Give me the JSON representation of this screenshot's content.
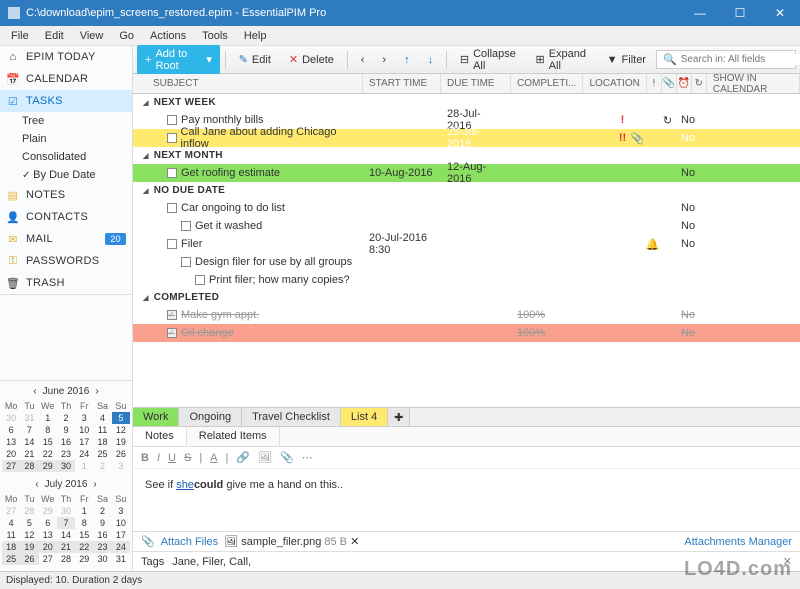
{
  "window": {
    "title": "C:\\download\\epim_screens_restored.epim - EssentialPIM Pro"
  },
  "menu": [
    "File",
    "Edit",
    "View",
    "Go",
    "Actions",
    "Tools",
    "Help"
  ],
  "sidebar": {
    "items": [
      {
        "label": "EPIM TODAY",
        "icon": "home"
      },
      {
        "label": "CALENDAR",
        "icon": "calendar"
      },
      {
        "label": "TASKS",
        "icon": "tasks",
        "active": true
      },
      {
        "label": "NOTES",
        "icon": "notes"
      },
      {
        "label": "CONTACTS",
        "icon": "contacts"
      },
      {
        "label": "MAIL",
        "icon": "mail",
        "badge": "20"
      },
      {
        "label": "PASSWORDS",
        "icon": "key"
      },
      {
        "label": "TRASH",
        "icon": "trash"
      }
    ],
    "tree": [
      {
        "label": "Tree"
      },
      {
        "label": "Plain"
      },
      {
        "label": "Consolidated"
      },
      {
        "label": "By Due Date",
        "checked": true
      }
    ]
  },
  "toolbar": {
    "add": "Add to Root",
    "edit": "Edit",
    "delete": "Delete",
    "collapse": "Collapse All",
    "expand": "Expand All",
    "filter": "Filter",
    "search_placeholder": "Search in: All fields"
  },
  "columns": {
    "subject": "SUBJECT",
    "start": "START TIME",
    "due": "DUE TIME",
    "completion": "COMPLETI...",
    "location": "LOCATION",
    "show": "SHOW IN CALENDAR"
  },
  "groups": {
    "next_week": "NEXT WEEK",
    "next_month": "NEXT MONTH",
    "no_due": "NO DUE DATE",
    "completed": "COMPLETED"
  },
  "tasks": [
    {
      "subject": "Pay monthly bills",
      "due": "28-Jul-2016",
      "show": "No",
      "priority": "!",
      "repeat": true
    },
    {
      "subject": "Call Jane about adding Chicago inflow",
      "due": "25-Jul-2016",
      "show": "No",
      "priority": "!!",
      "attach": true,
      "selected": true,
      "yellow": true
    },
    {
      "subject": "Get roofing estimate",
      "start": "10-Aug-2016",
      "due": "12-Aug-2016",
      "show": "No",
      "green": true
    },
    {
      "subject": "Car ongoing to do list",
      "show": "No",
      "marker": true
    },
    {
      "subject": "Get it washed",
      "show": "No",
      "indent": 2
    },
    {
      "subject": "Filer",
      "start": "20-Jul-2016 8:30",
      "show": "No",
      "reminder": true
    },
    {
      "subject": "Design filer for use by all groups",
      "indent": 2
    },
    {
      "subject": "Print filer; how many copies?",
      "indent": 3
    },
    {
      "subject": "Make gym appt.",
      "completion": "100%",
      "show": "No",
      "done": true
    },
    {
      "subject": "Oil change",
      "completion": "100%",
      "show": "No",
      "done": true,
      "peach": true
    }
  ],
  "detail": {
    "tabs": [
      {
        "label": "Work",
        "color": "green"
      },
      {
        "label": "Ongoing",
        "color": "grey"
      },
      {
        "label": "Travel Checklist",
        "color": "grey"
      },
      {
        "label": "List 4",
        "color": "yellow"
      }
    ],
    "subtabs": [
      "Notes",
      "Related Items"
    ],
    "body_prefix": "See if ",
    "body_link": "she",
    "body_bold": "could",
    "body_suffix": " give me a hand on this..",
    "attach_label": "Attach Files",
    "attach_file": "sample_filer.png",
    "attach_size": "85 B",
    "attach_mgr": "Attachments Manager",
    "tags_label": "Tags",
    "tags_value": "Jane, Filer, Call,"
  },
  "calendar": {
    "months": [
      {
        "label": "June  2016",
        "dow": [
          "Mo",
          "Tu",
          "We",
          "Th",
          "Fr",
          "Sa",
          "Su"
        ],
        "rows": [
          [
            {
              "d": 30,
              "dim": 1
            },
            {
              "d": 31,
              "dim": 1
            },
            {
              "d": 1
            },
            {
              "d": 2
            },
            {
              "d": 3
            },
            {
              "d": 4
            },
            {
              "d": 5,
              "today": 1
            }
          ],
          [
            {
              "d": 6
            },
            {
              "d": 7
            },
            {
              "d": 8
            },
            {
              "d": 9
            },
            {
              "d": 10
            },
            {
              "d": 11
            },
            {
              "d": 12
            }
          ],
          [
            {
              "d": 13
            },
            {
              "d": 14
            },
            {
              "d": 15
            },
            {
              "d": 16
            },
            {
              "d": 17
            },
            {
              "d": 18
            },
            {
              "d": 19
            }
          ],
          [
            {
              "d": 20
            },
            {
              "d": 21
            },
            {
              "d": 22
            },
            {
              "d": 23
            },
            {
              "d": 24
            },
            {
              "d": 25
            },
            {
              "d": 26
            }
          ],
          [
            {
              "d": 27,
              "hl": 1
            },
            {
              "d": 28,
              "hl": 1
            },
            {
              "d": 29,
              "hl": 1
            },
            {
              "d": 30,
              "hl": 1
            },
            {
              "d": 1,
              "dim": 1
            },
            {
              "d": 2,
              "dim": 1
            },
            {
              "d": 3,
              "dim": 1
            }
          ]
        ]
      },
      {
        "label": "July  2016",
        "dow": [
          "Mo",
          "Tu",
          "We",
          "Th",
          "Fr",
          "Sa",
          "Su"
        ],
        "rows": [
          [
            {
              "d": 27,
              "dim": 1
            },
            {
              "d": 28,
              "dim": 1
            },
            {
              "d": 29,
              "dim": 1
            },
            {
              "d": 30,
              "dim": 1
            },
            {
              "d": 1
            },
            {
              "d": 2
            },
            {
              "d": 3
            }
          ],
          [
            {
              "d": 4
            },
            {
              "d": 5
            },
            {
              "d": 6
            },
            {
              "d": 7,
              "hl": 1
            },
            {
              "d": 8
            },
            {
              "d": 9
            },
            {
              "d": 10
            }
          ],
          [
            {
              "d": 11
            },
            {
              "d": 12
            },
            {
              "d": 13
            },
            {
              "d": 14
            },
            {
              "d": 15
            },
            {
              "d": 16
            },
            {
              "d": 17
            }
          ],
          [
            {
              "d": 18,
              "hl": 1
            },
            {
              "d": 19,
              "hl": 1
            },
            {
              "d": 20,
              "hl": 1
            },
            {
              "d": 21,
              "hl": 1
            },
            {
              "d": 22,
              "hl": 1
            },
            {
              "d": 23,
              "hl": 1
            },
            {
              "d": 24,
              "hl": 1
            }
          ],
          [
            {
              "d": 25,
              "hl": 1
            },
            {
              "d": 26,
              "hl": 1
            },
            {
              "d": 27
            },
            {
              "d": 28
            },
            {
              "d": 29
            },
            {
              "d": 30
            },
            {
              "d": 31
            }
          ]
        ]
      }
    ]
  },
  "status": "Displayed: 10. Duration 2 days",
  "watermark": "LO4D.com"
}
